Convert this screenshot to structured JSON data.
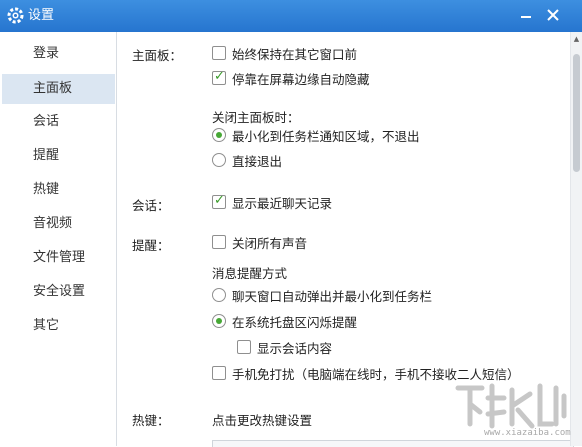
{
  "window": {
    "title": "设置"
  },
  "sidebar": {
    "items": [
      {
        "label": "登录"
      },
      {
        "label": "主面板"
      },
      {
        "label": "会话"
      },
      {
        "label": "提醒"
      },
      {
        "label": "热键"
      },
      {
        "label": "音视频"
      },
      {
        "label": "文件管理"
      },
      {
        "label": "安全设置"
      },
      {
        "label": "其它"
      }
    ],
    "active": "主面板"
  },
  "main_panel": {
    "label": "主面板：",
    "always_on_top": {
      "label": "始终保持在其它窗口前",
      "checked": false
    },
    "dock_hide": {
      "label": "停靠在屏幕边缘自动隐藏",
      "checked": true
    },
    "close_heading": "关闭主面板时：",
    "minimize_tray": {
      "label": "最小化到任务栏通知区域，不退出",
      "selected": true
    },
    "exit_directly": {
      "label": "直接退出",
      "selected": false
    }
  },
  "session": {
    "label": "会话：",
    "show_recent": {
      "label": "显示最近聊天记录",
      "checked": true
    }
  },
  "reminder": {
    "label": "提醒：",
    "mute_all": {
      "label": "关闭所有声音",
      "checked": false
    },
    "method_heading": "消息提醒方式",
    "popup_minimize": {
      "label": "聊天窗口自动弹出并最小化到任务栏",
      "selected": false
    },
    "tray_flash": {
      "label": "在系统托盘区闪烁提醒",
      "selected": true
    },
    "show_content": {
      "label": "显示会话内容",
      "checked": false
    },
    "phone_no_disturb": {
      "label": "手机免打扰（电脑端在线时，手机不接收二人短信）",
      "checked": false
    }
  },
  "hotkey": {
    "label": "热键：",
    "change_link": "点击更改热键设置"
  },
  "watermark": {
    "text": "www.xiazaiba.com"
  },
  "colors": {
    "titlebar": "#2675cf",
    "active_nav": "#dbe6f2",
    "check": "#3a9b2a",
    "radio": "#47a836"
  }
}
